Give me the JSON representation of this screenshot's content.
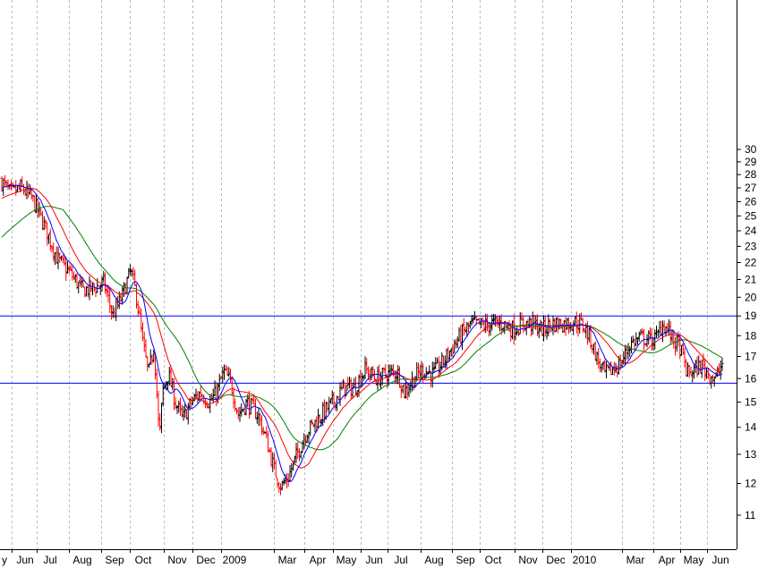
{
  "chart_data": {
    "type": "ohlc",
    "title": "",
    "xlabel": "",
    "ylabel": "",
    "ylim": [
      10.3,
      30.5
    ],
    "y_scale": "log",
    "y_ticks": [
      "11",
      "12",
      "13",
      "14",
      "15",
      "16",
      "17",
      "18",
      "19",
      "20",
      "21",
      "22",
      "23",
      "24",
      "25",
      "26",
      "27",
      "28",
      "29",
      "30"
    ],
    "x_ticks": [
      "y",
      "Jun",
      "Jul",
      "Aug",
      "Sep",
      "Oct",
      "Nov",
      "Dec",
      "2009",
      "Mar",
      "Apr",
      "May",
      "Jun",
      "Jul",
      "Aug",
      "Sep",
      "Oct",
      "Nov",
      "Dec",
      "2010",
      "Mar",
      "Apr",
      "May",
      "Jun"
    ],
    "vertical_grid": "dashed",
    "colors": {
      "up_bar": "#000000",
      "down_bar": "#ff0000",
      "ma_short": "#0000ff",
      "ma_medium": "#ff0000",
      "ma_long": "#008000",
      "horizontal_lines": "#0000ff",
      "grid": "#bbbbbb"
    },
    "horizontal_lines": [
      19.0,
      15.8
    ],
    "price_path": [
      [
        0,
        27.6
      ],
      [
        12,
        26.6
      ],
      [
        24,
        27.0
      ],
      [
        36,
        26.2
      ],
      [
        52,
        24.0
      ],
      [
        64,
        22.2
      ],
      [
        78,
        21.4
      ],
      [
        92,
        20.4
      ],
      [
        104,
        20.5
      ],
      [
        116,
        20.8
      ],
      [
        126,
        19.0
      ],
      [
        136,
        20.0
      ],
      [
        146,
        21.5
      ],
      [
        152,
        20.2
      ],
      [
        160,
        17.5
      ],
      [
        166,
        16.2
      ],
      [
        172,
        17.5
      ],
      [
        178,
        13.5
      ],
      [
        182,
        15.5
      ],
      [
        188,
        16.2
      ],
      [
        196,
        15.0
      ],
      [
        204,
        14.3
      ],
      [
        214,
        15.0
      ],
      [
        224,
        15.4
      ],
      [
        234,
        15.0
      ],
      [
        242,
        15.4
      ],
      [
        250,
        16.3
      ],
      [
        258,
        15.8
      ],
      [
        266,
        14.5
      ],
      [
        276,
        15.0
      ],
      [
        288,
        14.5
      ],
      [
        298,
        13.5
      ],
      [
        306,
        12.5
      ],
      [
        314,
        11.9
      ],
      [
        322,
        12.2
      ],
      [
        332,
        13.0
      ],
      [
        342,
        13.8
      ],
      [
        352,
        14.2
      ],
      [
        362,
        14.6
      ],
      [
        372,
        15.0
      ],
      [
        384,
        15.6
      ],
      [
        396,
        15.6
      ],
      [
        408,
        16.4
      ],
      [
        420,
        16.0
      ],
      [
        432,
        16.2
      ],
      [
        444,
        16.3
      ],
      [
        452,
        15.4
      ],
      [
        462,
        16.0
      ],
      [
        472,
        16.4
      ],
      [
        484,
        16.2
      ],
      [
        496,
        16.8
      ],
      [
        508,
        17.6
      ],
      [
        518,
        18.2
      ],
      [
        528,
        18.6
      ],
      [
        540,
        18.5
      ],
      [
        552,
        18.6
      ],
      [
        562,
        18.6
      ],
      [
        574,
        18.3
      ],
      [
        584,
        18.6
      ],
      [
        596,
        18.6
      ],
      [
        606,
        18.3
      ],
      [
        618,
        18.6
      ],
      [
        630,
        18.6
      ],
      [
        642,
        18.7
      ],
      [
        652,
        18.5
      ],
      [
        660,
        17.8
      ],
      [
        668,
        16.8
      ],
      [
        676,
        16.2
      ],
      [
        684,
        16.4
      ],
      [
        694,
        16.7
      ],
      [
        704,
        17.6
      ],
      [
        716,
        17.9
      ],
      [
        726,
        17.8
      ],
      [
        734,
        17.9
      ],
      [
        740,
        18.6
      ],
      [
        746,
        18.3
      ],
      [
        752,
        17.8
      ],
      [
        760,
        17.4
      ],
      [
        768,
        16.2
      ],
      [
        776,
        16.4
      ],
      [
        784,
        16.6
      ],
      [
        792,
        16.2
      ],
      [
        800,
        16.0
      ],
      [
        806,
        16.6
      ],
      [
        810,
        17.0
      ]
    ]
  }
}
